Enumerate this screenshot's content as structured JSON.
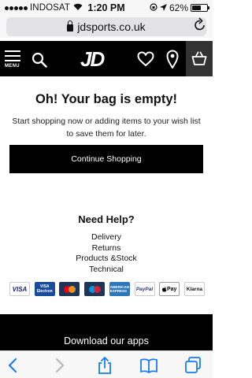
{
  "status_bar": {
    "carrier": "INDOSAT",
    "time": "1:20 PM",
    "battery_text": "62%",
    "battery_level": 0.62,
    "icons": [
      "signal-dots-icon",
      "wifi-icon",
      "location-arrow-icon",
      "orientation-lock-icon",
      "battery-icon"
    ]
  },
  "browser": {
    "url": "jdsports.co.uk"
  },
  "header": {
    "menu_label": "MENU",
    "logo": "JD",
    "icons": [
      "menu-icon",
      "search-icon",
      "heart-icon",
      "location-pin-icon",
      "bag-icon"
    ]
  },
  "bag": {
    "title": "Oh! Your bag is empty!",
    "description": "Start shopping now or adding items to your wish list to save them for later.",
    "button": "Continue Shopping"
  },
  "help": {
    "title": "Need Help?",
    "links": [
      "Delivery",
      "Returns",
      "Products &Stock",
      "Technical"
    ]
  },
  "payments": {
    "visa": "VISA",
    "electron_top": "VISA",
    "electron_bottom": "Electron",
    "amex": "AMERICAN EXPRESS",
    "paypal": "PayPal",
    "applepay": "Pay",
    "klarna": "Klarna"
  },
  "footer": {
    "download": "Download our apps"
  },
  "colors": {
    "header_bg": "#000000",
    "bag_cell_bg": "#333333",
    "safari_blue": "#1a7cf5"
  }
}
